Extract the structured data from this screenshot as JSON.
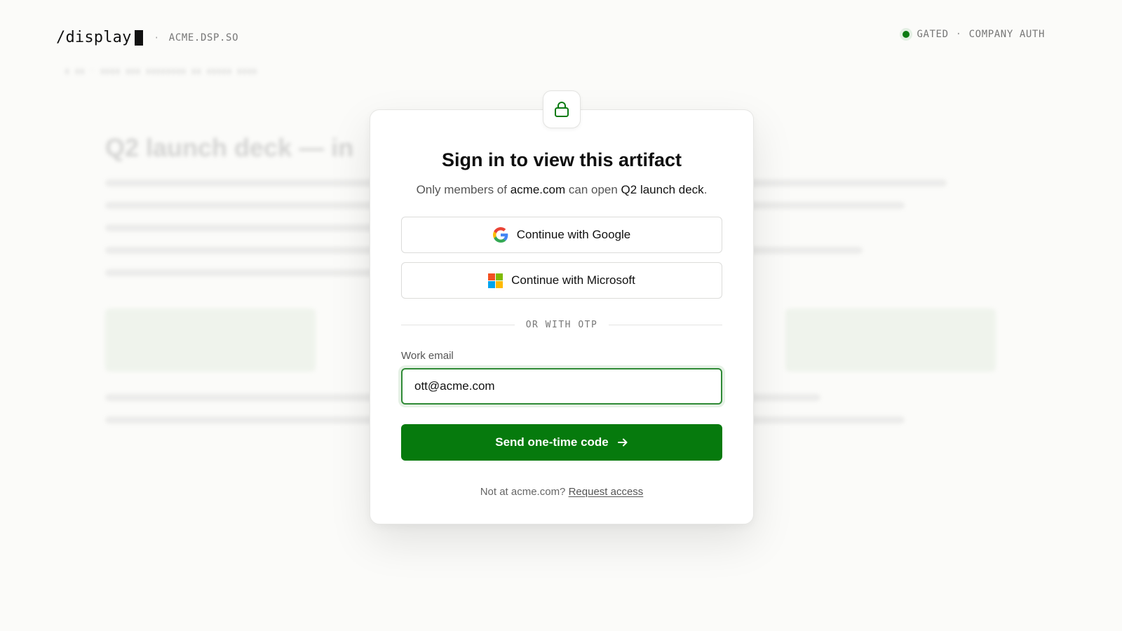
{
  "header": {
    "logo": "/display",
    "separator": "·",
    "domain": "ACME.DSP.SO",
    "status": {
      "label": "GATED",
      "separator": "·",
      "mode": "COMPANY AUTH",
      "dot_color": "#0a7a12"
    }
  },
  "background": {
    "title": "Q2 launch deck — in"
  },
  "card": {
    "lock_icon": "lock-icon",
    "title": "Sign in to view this artifact",
    "subtitle": {
      "prefix": "Only members of ",
      "org": "acme.com",
      "middle": " can open ",
      "artifact": "Q2 launch deck",
      "suffix": "."
    },
    "google_button": "Continue with Google",
    "microsoft_button": "Continue with Microsoft",
    "divider": "OR WITH OTP",
    "email_label": "Work email",
    "email_value": "ott@acme.com",
    "submit_button": "Send one-time code",
    "footer": {
      "prefix": "Not at acme.com? ",
      "link": "Request access"
    }
  },
  "colors": {
    "accent": "#067a0d",
    "focus_border": "#2f8a36"
  }
}
